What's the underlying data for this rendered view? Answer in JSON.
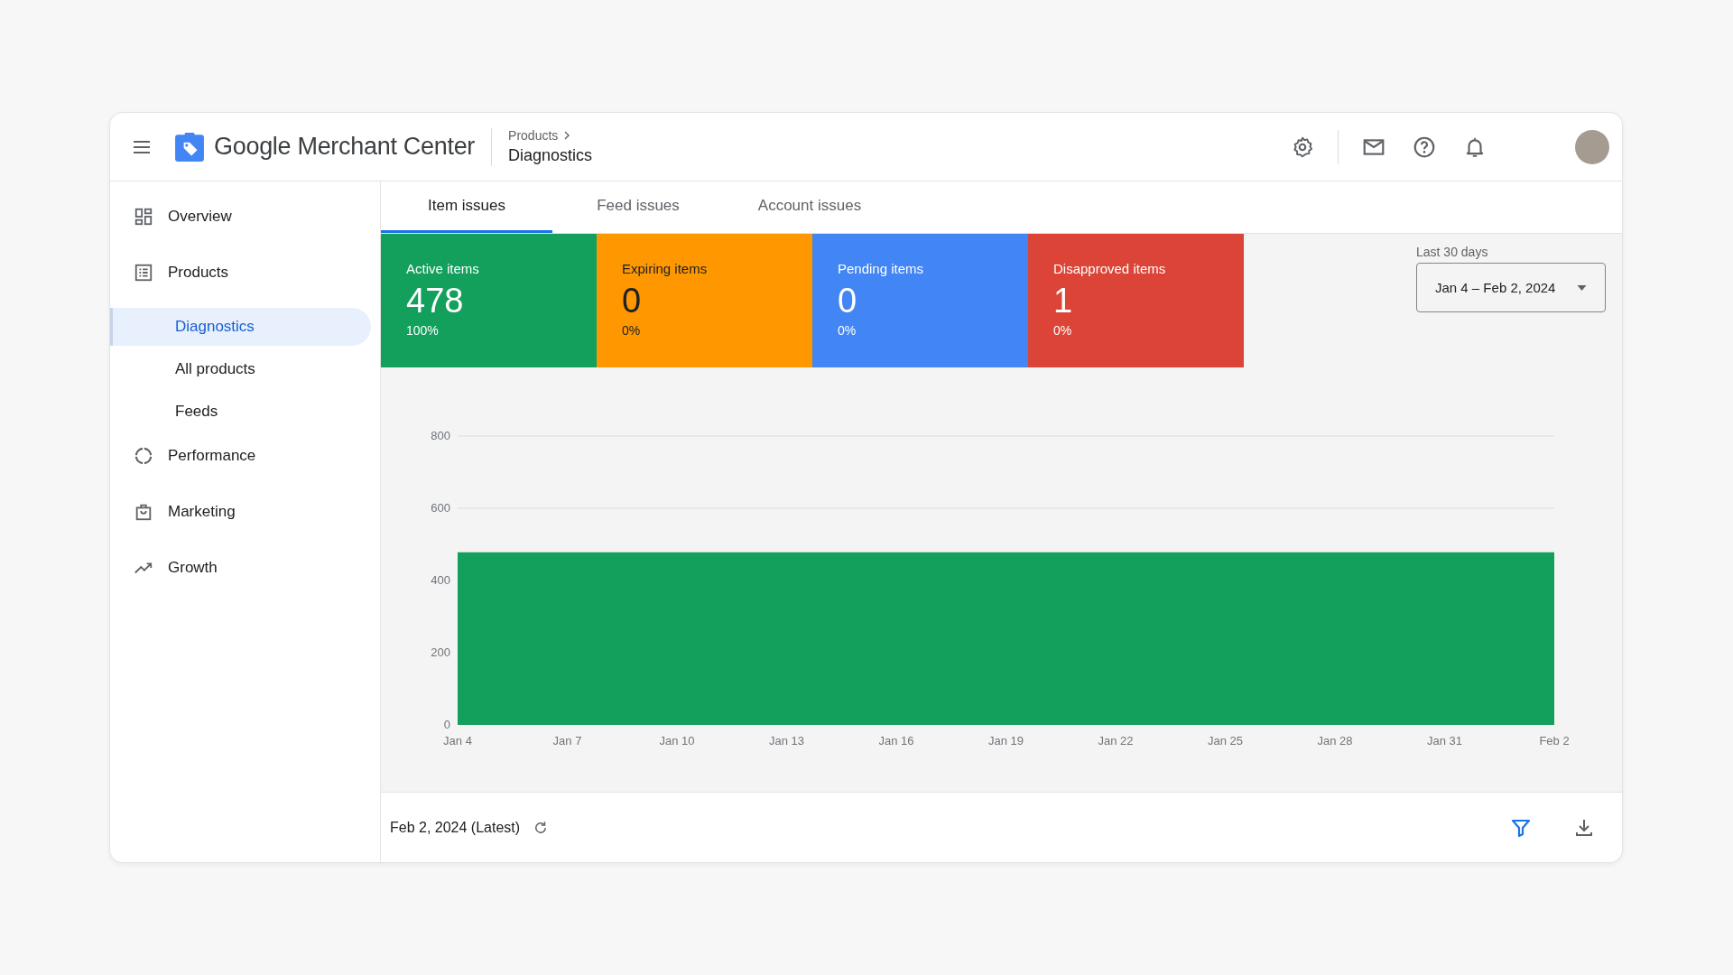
{
  "app": {
    "title": "Google Merchant Center"
  },
  "breadcrumb": {
    "parent": "Products",
    "current": "Diagnostics"
  },
  "sidebar": {
    "items": [
      {
        "label": "Overview",
        "kind": "overview",
        "selected": false
      },
      {
        "label": "Products",
        "kind": "products",
        "selected": false,
        "children": [
          {
            "label": "Diagnostics",
            "selected": true
          },
          {
            "label": "All products",
            "selected": false
          },
          {
            "label": "Feeds",
            "selected": false
          }
        ]
      },
      {
        "label": "Performance",
        "kind": "performance",
        "selected": false
      },
      {
        "label": "Marketing",
        "kind": "marketing",
        "selected": false
      },
      {
        "label": "Growth",
        "kind": "growth",
        "selected": false
      }
    ]
  },
  "tabs": [
    {
      "label": "Item issues",
      "selected": true
    },
    {
      "label": "Feed issues",
      "selected": false
    },
    {
      "label": "Account issues",
      "selected": false
    }
  ],
  "cards": [
    {
      "label": "Active items",
      "value": "478",
      "percent": "100%",
      "color": "#12a05c"
    },
    {
      "label": "Expiring items",
      "value": "0",
      "percent": "0%",
      "color": "#ff9800"
    },
    {
      "label": "Pending items",
      "value": "0",
      "percent": "0%",
      "color": "#4285f4"
    },
    {
      "label": "Disapproved items",
      "value": "1",
      "percent": "0%",
      "color": "#db4437"
    }
  ],
  "date_range": {
    "label": "Last 30 days",
    "value": "Jan 4 – Feb 2, 2024"
  },
  "chart": {
    "chart_data": {
      "type": "area",
      "x": [
        "Jan 4",
        "Jan 7",
        "Jan 10",
        "Jan 13",
        "Jan 16",
        "Jan 19",
        "Jan 22",
        "Jan 25",
        "Jan 28",
        "Jan 31",
        "Feb 2"
      ],
      "series": [
        {
          "color": "#12a05c",
          "values": [
            478,
            478,
            478,
            478,
            478,
            478,
            478,
            478,
            478,
            478,
            478
          ]
        }
      ],
      "ylim": [
        0,
        800
      ],
      "yticks": [
        0,
        200,
        400,
        600,
        800
      ]
    }
  },
  "footer": {
    "date": "Feb 2, 2024 (Latest)"
  }
}
